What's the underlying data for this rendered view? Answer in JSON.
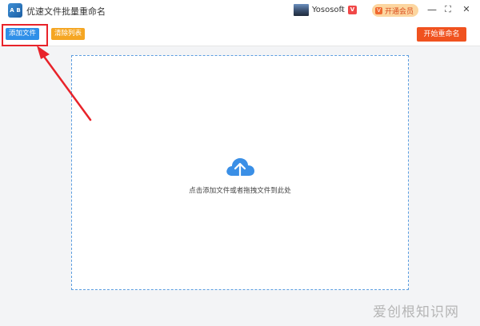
{
  "titlebar": {
    "app_title": "优速文件批量重命名",
    "logo_letters": [
      "A",
      "B"
    ],
    "user_name": "Yososoft",
    "vip_badge_glyph": "V",
    "open_vip_label": "开通会员",
    "open_vip_icon_glyph": "V",
    "minimize_glyph": "—",
    "maximize_glyph": "⛶",
    "close_glyph": "✕",
    "chevron_glyph": "⌄"
  },
  "toolbar": {
    "add_files_label": "添加文件",
    "clear_list_label": "清除列表",
    "start_rename_label": "开始重命名"
  },
  "drop_zone": {
    "hint": "点击添加文件或者拖拽文件到此处"
  },
  "watermark": {
    "text": "爱创根知识网"
  },
  "colors": {
    "primary_blue": "#2f8fe8",
    "clear_orange": "#f5a623",
    "start_red": "#f0521f",
    "highlight_red": "#e8232a",
    "dropzone_border": "#5b9de0"
  }
}
